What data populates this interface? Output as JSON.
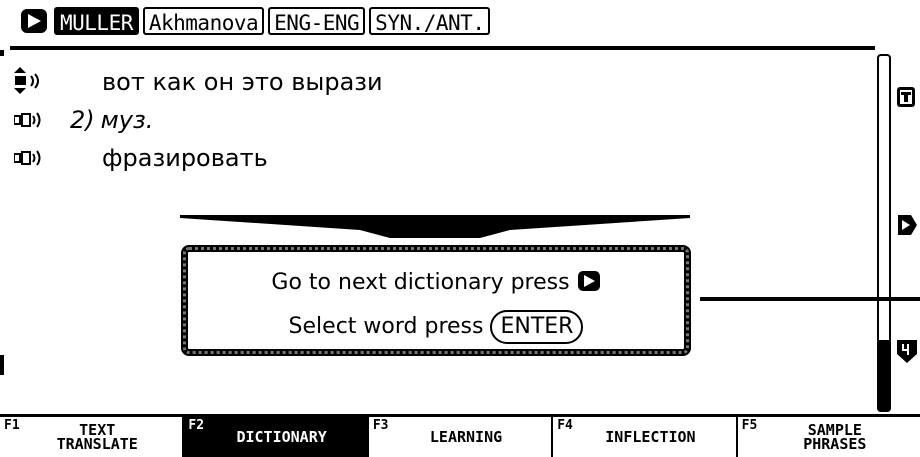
{
  "tabs": [
    {
      "label": "MULLER",
      "active": true
    },
    {
      "label": "Akhmanova",
      "active": false
    },
    {
      "label": "ENG-ENG",
      "active": false
    },
    {
      "label": "SYN./ANT.",
      "active": false
    }
  ],
  "entry": {
    "line1": "вот как он это вырази",
    "line2_num": "2)",
    "line2": "муз.",
    "line3": "фразировать"
  },
  "popup": {
    "line1": "Go to next dictionary press",
    "line2": "Select word press",
    "enter_key": "ENTER"
  },
  "side": {
    "top_icon": "T-icon",
    "middle_icon": "next-arrow-icon",
    "bottom_icon": "page-down-icon"
  },
  "function_keys": [
    {
      "key": "F1",
      "label": "TEXT TRANSLATE",
      "active": false
    },
    {
      "key": "F2",
      "label": "DICTIONARY",
      "active": true
    },
    {
      "key": "F3",
      "label": "LEARNING",
      "active": false
    },
    {
      "key": "F4",
      "label": "INFLECTION",
      "active": false
    },
    {
      "key": "F5",
      "label": "SAMPLE PHRASES",
      "active": false
    }
  ]
}
